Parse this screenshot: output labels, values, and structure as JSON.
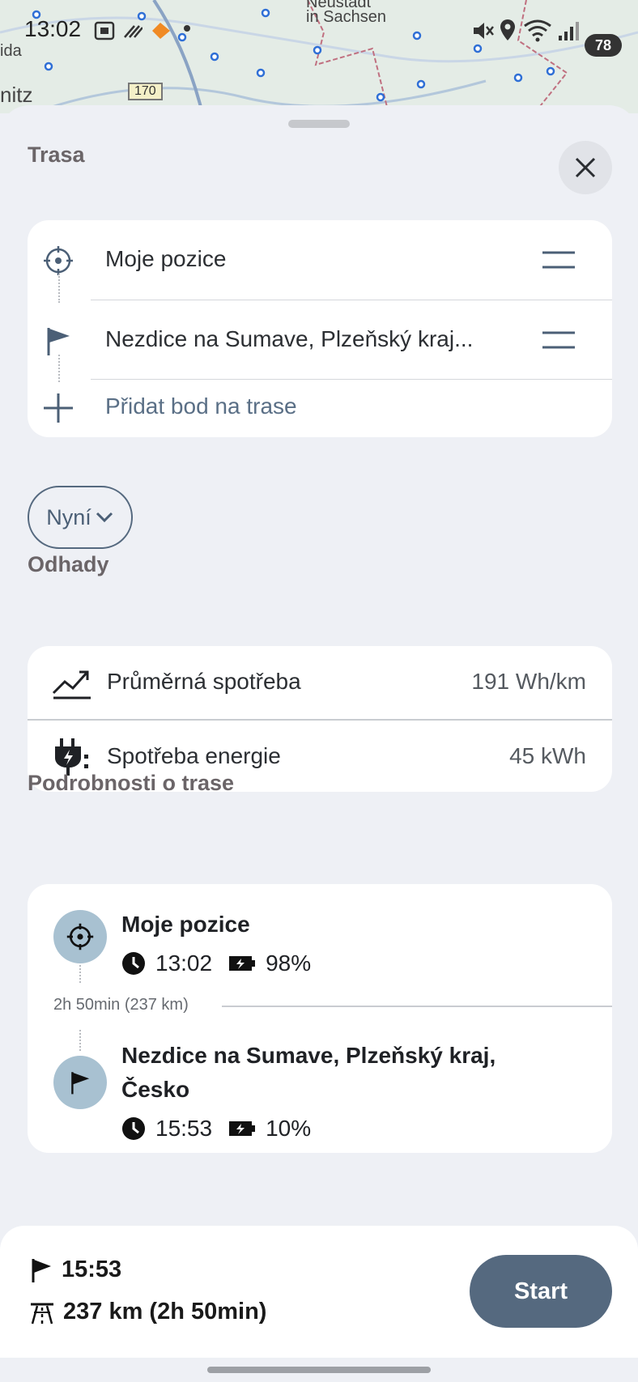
{
  "status": {
    "time": "13:02",
    "battery": "78"
  },
  "map": {
    "label_left": "ida",
    "label_left2": "nitz",
    "label_city1": "Neustadt",
    "label_city2": "in Sachsen",
    "road_number": "170"
  },
  "route": {
    "title": "Trasa",
    "start": "Moje pozice",
    "destination": "Nezdice na Sumave, Plzeňský kraj...",
    "add_stop": "Přidat bod na trase",
    "time_chip": "Nyní"
  },
  "estimates": {
    "title": "Odhady",
    "rows": [
      {
        "label": "Průměrná spotřeba",
        "value": "191 Wh/km"
      },
      {
        "label": "Spotřeba energie",
        "value": "45 kWh"
      }
    ]
  },
  "details": {
    "title": "Podrobnosti o trase",
    "origin": {
      "name": "Moje pozice",
      "time": "13:02",
      "battery": "98%"
    },
    "leg": "2h 50min (237 km)",
    "destination": {
      "name_line1": "Nezdice na Sumave, Plzeňský kraj,",
      "name_line2": "Česko",
      "time": "15:53",
      "battery": "10%"
    }
  },
  "summary": {
    "arrival": "15:53",
    "distance": "237 km (2h 50min)",
    "start_label": "Start"
  },
  "colors": {
    "accent": "#55697f",
    "stop_circle": "#a8c1d1",
    "background": "#eef0f5"
  }
}
